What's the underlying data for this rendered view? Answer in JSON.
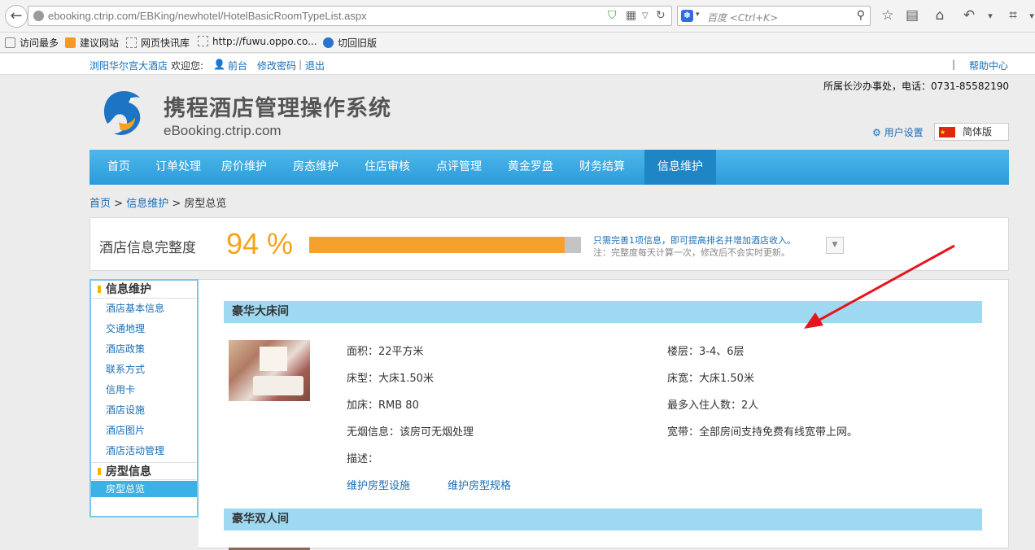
{
  "browser": {
    "url": "ebooking.ctrip.com/EBKing/newhotel/HotelBasicRoomTypeList.aspx",
    "search_placeholder": "百度 <Ctrl+K>",
    "bookmarks": [
      "访问最多",
      "建议网站",
      "网页快讯库",
      "http://fuwu.oppo.co...",
      "切回旧版"
    ]
  },
  "topbar": {
    "hotel_name": "浏阳华尔宫大酒店",
    "welcome": "欢迎您:",
    "user": "前台",
    "change_password": "修改密码",
    "separator": "|",
    "logout": "退出",
    "help": "帮助中心"
  },
  "header": {
    "title": "携程酒店管理操作系统",
    "subtitle": "eBooking.ctrip.com",
    "office_phone": "所属长沙办事处，电话：0731-85582190",
    "user_settings": "用户设置",
    "language": "简体版"
  },
  "main_nav": [
    "首页",
    "订单处理",
    "房价维护",
    "房态维护",
    "住店审核",
    "点评管理",
    "黄金罗盘",
    "财务结算",
    "信息维护"
  ],
  "breadcrumb": {
    "home": "首页",
    "sep1": ">",
    "section": "信息维护",
    "sep2": ">",
    "current": "房型总览"
  },
  "completeness": {
    "label": "酒店信息完整度",
    "percent_text": "94 %",
    "progress": 0.94,
    "tip_line1": "只需完善1项信息，即可提高排名并增加酒店收入。",
    "tip_line2": "注：完整度每天计算一次，修改后不会实时更新。"
  },
  "sidebar": {
    "group1_title": "信息维护",
    "group1_items": [
      "酒店基本信息",
      "交通地理",
      "酒店政策",
      "联系方式",
      "信用卡",
      "酒店设施",
      "酒店图片",
      "酒店活动管理"
    ],
    "group2_title": "房型信息",
    "group2_items": [
      "房型总览"
    ]
  },
  "rooms": [
    {
      "name": "豪华大床间",
      "area": "面积：22平方米",
      "floor": "楼层：3-4、6层",
      "bed_type": "床型：大床1.50米",
      "bed_width": "床宽：大床1.50米",
      "extra_bed": "加床：RMB 80",
      "max_guests": "最多入住人数：2人",
      "non_smoking": "无烟信息：该房可无烟处理",
      "broadband": "宽带：全部房间支持免费有线宽带上网。",
      "description": "描述：",
      "link_facilities": "维护房型设施",
      "link_specs": "维护房型规格"
    },
    {
      "name": "豪华双人间"
    }
  ]
}
